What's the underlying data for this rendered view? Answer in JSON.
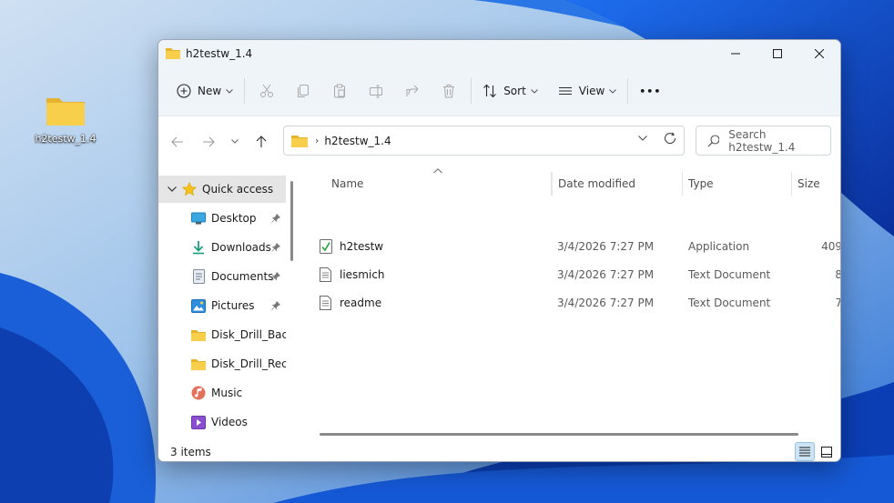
{
  "desktop": {
    "icon_label": "h2testw_1.4"
  },
  "window": {
    "title": "h2testw_1.4",
    "controls": {
      "minimize": "—",
      "maximize": "☐",
      "close": "✕"
    }
  },
  "toolbar": {
    "new_label": "New",
    "sort_label": "Sort",
    "view_label": "View",
    "more_label": "•••"
  },
  "address": {
    "path": "h2testw_1.4",
    "search_placeholder": "Search h2testw_1.4"
  },
  "nav": {
    "quick_access": "Quick access",
    "items": [
      {
        "label": "Desktop",
        "icon": "desktop-icon",
        "pinned": true
      },
      {
        "label": "Downloads",
        "icon": "download-icon",
        "pinned": true
      },
      {
        "label": "Documents",
        "icon": "documents-icon",
        "pinned": true
      },
      {
        "label": "Pictures",
        "icon": "pictures-icon",
        "pinned": true
      },
      {
        "label": "Disk_Drill_Backu",
        "icon": "folder-icon",
        "pinned": false
      },
      {
        "label": "Disk_Drill_Recov",
        "icon": "folder-icon",
        "pinned": false
      },
      {
        "label": "Music",
        "icon": "music-icon",
        "pinned": false
      },
      {
        "label": "Videos",
        "icon": "videos-icon",
        "pinned": false
      }
    ]
  },
  "columns": {
    "name": "Name",
    "date": "Date modified",
    "type": "Type",
    "size": "Size"
  },
  "files": [
    {
      "name": "h2testw",
      "date": "3/4/2026 7:27 PM",
      "type": "Application",
      "size": "409",
      "icon": "application-icon"
    },
    {
      "name": "liesmich",
      "date": "3/4/2026 7:27 PM",
      "type": "Text Document",
      "size": "8",
      "icon": "text-file-icon"
    },
    {
      "name": "readme",
      "date": "3/4/2026 7:27 PM",
      "type": "Text Document",
      "size": "7",
      "icon": "text-file-icon"
    }
  ],
  "status": {
    "item_count": "3 items"
  },
  "colors": {
    "accent": "#0067c0",
    "folder_yellow": "#f8cf4b",
    "selected_nav": "#e5e5e5"
  }
}
